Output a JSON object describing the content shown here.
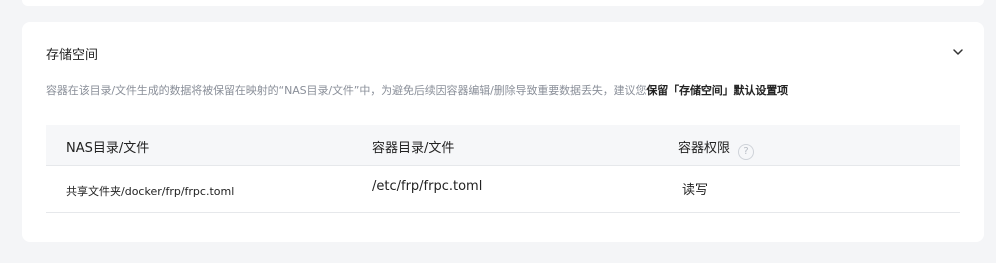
{
  "section": {
    "title": "存储空间",
    "description_prefix": "容器在该目录/文件生成的数据将被保留在映射的“NAS目录/文件”中，为避免后续因容器编辑/删除导致重要数据丢失，建议您",
    "description_bold": "保留「存储空间」默认设置项"
  },
  "table": {
    "headers": [
      "NAS目录/文件",
      "容器目录/文件",
      "容器权限"
    ],
    "help_icon_glyph": "?",
    "rows": [
      {
        "nas_path": "共享文件夹/docker/frp/frpc.toml",
        "container_path": "/etc/frp/frpc.toml",
        "permission": "读写"
      }
    ]
  },
  "icons": {
    "collapse": "chevron-down-icon",
    "help": "help-circle-icon"
  }
}
